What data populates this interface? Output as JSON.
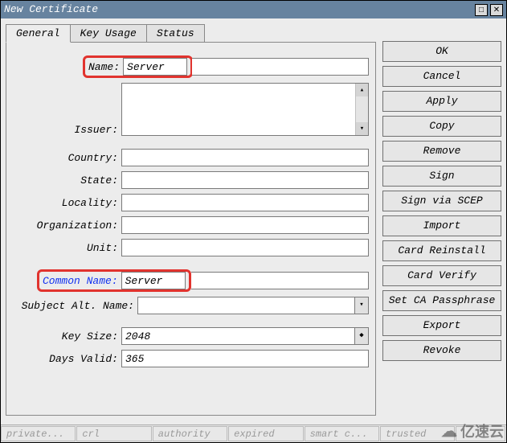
{
  "window": {
    "title": "New Certificate"
  },
  "title_buttons": {
    "max": "□",
    "close": "✕"
  },
  "tabs": [
    {
      "label": "General",
      "active": true
    },
    {
      "label": "Key Usage",
      "active": false
    },
    {
      "label": "Status",
      "active": false
    }
  ],
  "form": {
    "name_label": "Name:",
    "name_value": "Server",
    "issuer_label": "Issuer:",
    "country_label": "Country:",
    "country_value": "",
    "state_label": "State:",
    "state_value": "",
    "locality_label": "Locality:",
    "locality_value": "",
    "organization_label": "Organization:",
    "organization_value": "",
    "unit_label": "Unit:",
    "unit_value": "",
    "common_name_label": "Common Name:",
    "common_name_value": "Server",
    "san_label": "Subject Alt. Name:",
    "san_value": "",
    "key_size_label": "Key Size:",
    "key_size_value": "2048",
    "days_valid_label": "Days Valid:",
    "days_valid_value": "365"
  },
  "buttons": {
    "ok": "OK",
    "cancel": "Cancel",
    "apply": "Apply",
    "copy": "Copy",
    "remove": "Remove",
    "sign": "Sign",
    "scep": "Sign via SCEP",
    "import": "Import",
    "reinstall": "Card Reinstall",
    "verify": "Card Verify",
    "ca_pass": "Set CA Passphrase",
    "export": "Export",
    "revoke": "Revoke"
  },
  "status": {
    "s1": "private...",
    "s2": "crl",
    "s3": "authority",
    "s4": "expired",
    "s5": "smart c...",
    "s6": "trusted"
  },
  "watermark": {
    "text": "亿速云"
  }
}
